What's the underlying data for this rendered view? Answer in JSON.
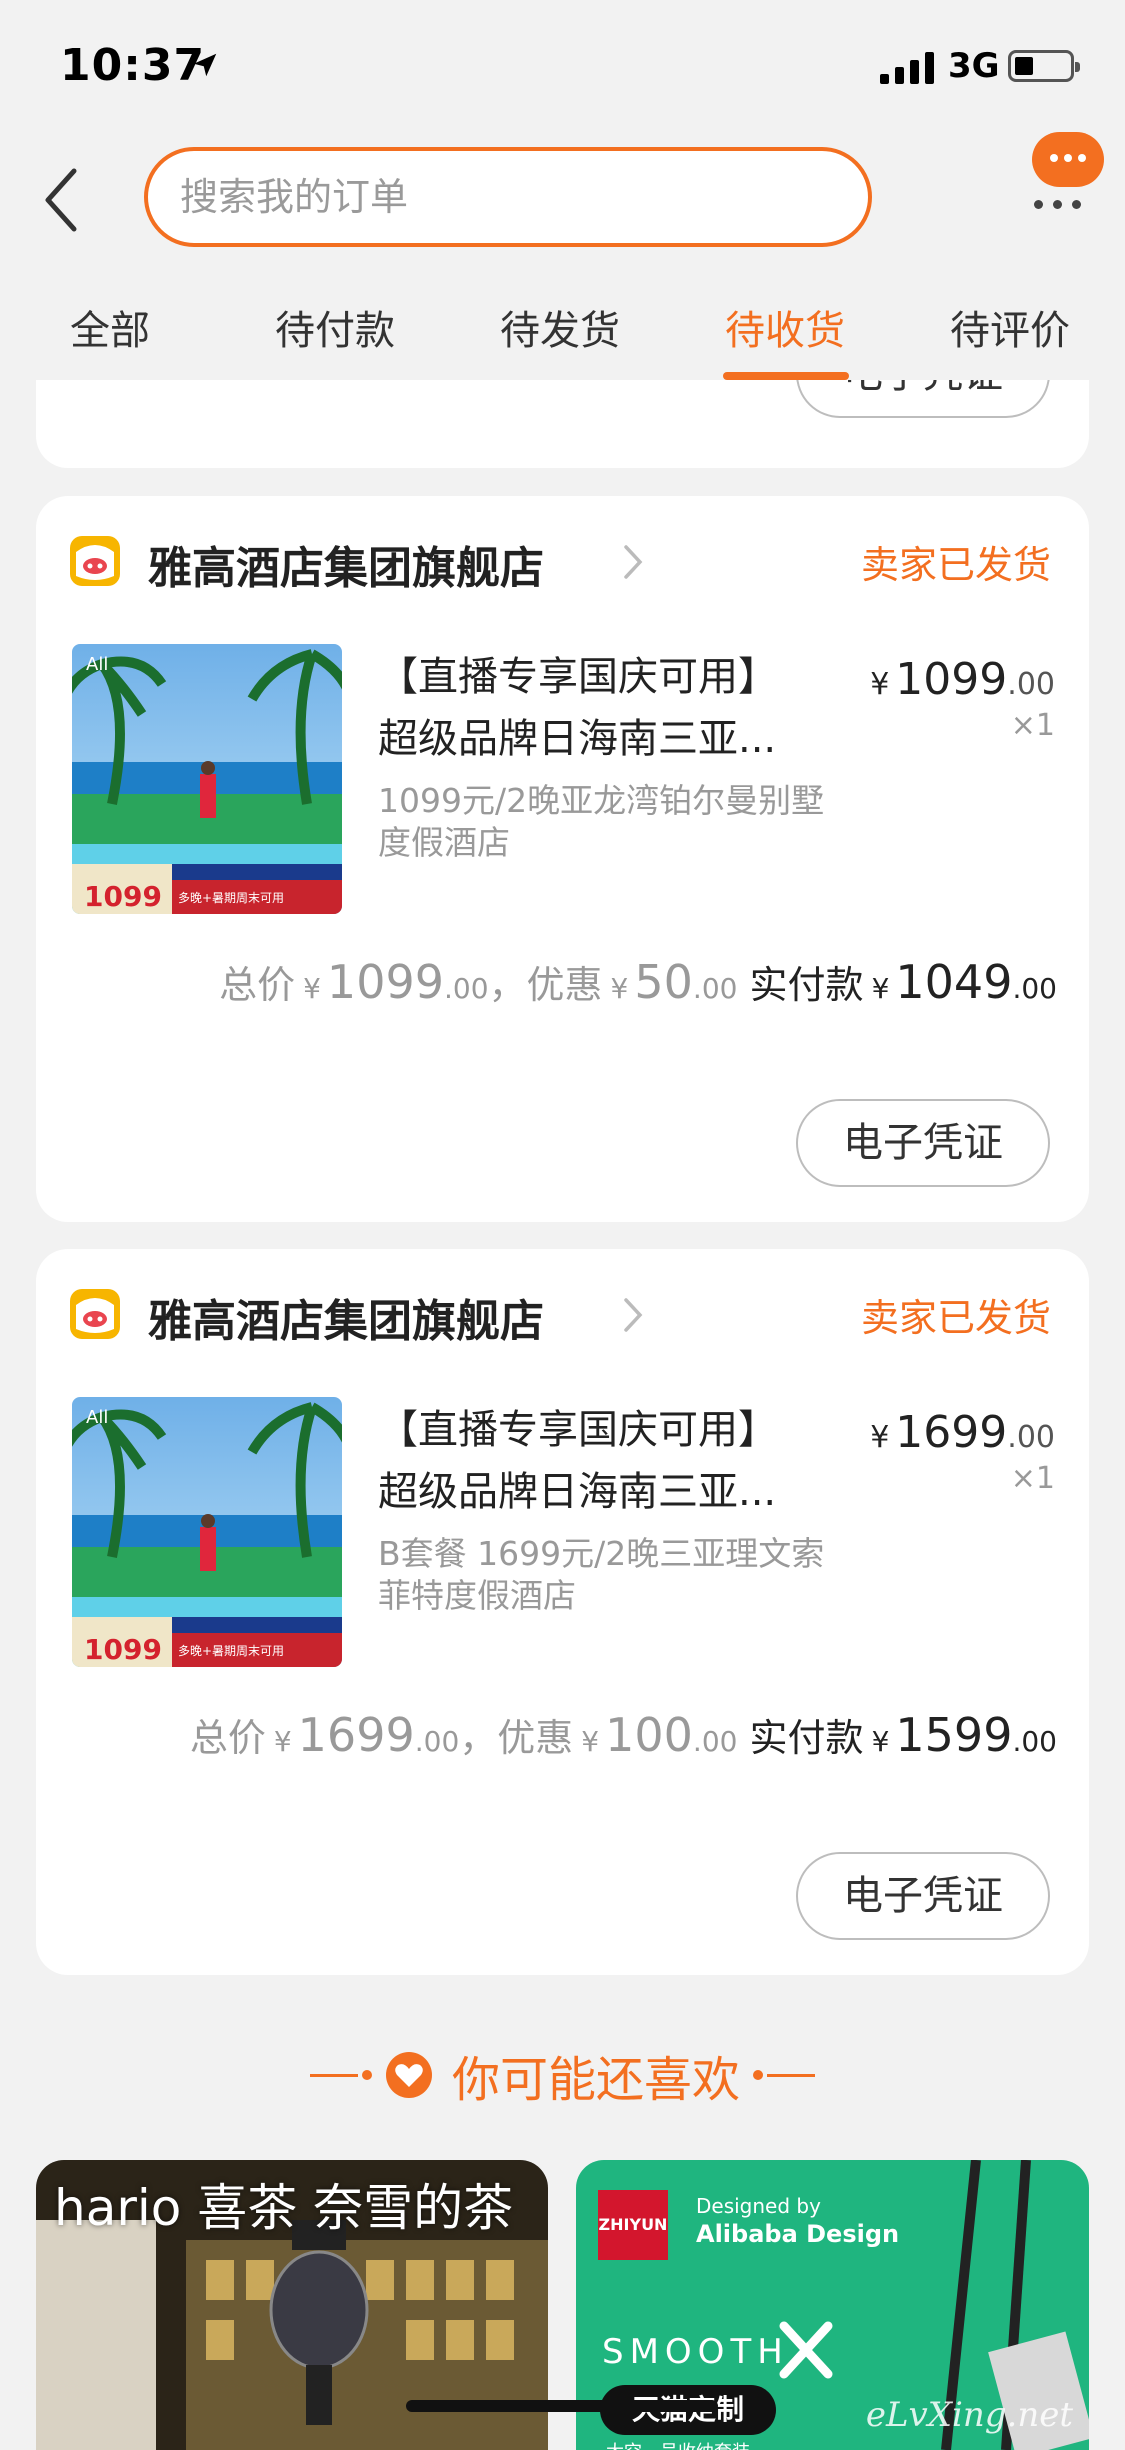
{
  "status_bar": {
    "time": "10:37",
    "network": "3G"
  },
  "search": {
    "placeholder": "搜索我的订单"
  },
  "tabs": [
    {
      "label": "全部"
    },
    {
      "label": "待付款"
    },
    {
      "label": "待发货"
    },
    {
      "label": "待收货",
      "active": true
    },
    {
      "label": "待评价"
    }
  ],
  "top_card": {
    "voucher_button": "电子凭证"
  },
  "orders": [
    {
      "shop_name": "雅高酒店集团旗舰店",
      "status": "卖家已发货",
      "product_title_1": "【直播专享国庆可用】",
      "product_title_2": "超级品牌日海南三亚...",
      "spec": "1099元/2晚亚龙湾铂尔曼别墅度假酒店",
      "price_currency": "¥",
      "price_int": "1099",
      "price_dec": ".00",
      "quantity": "×1",
      "total_label": "总价",
      "total_int": "1099",
      "total_dec": ".00",
      "discount_label": "，优惠",
      "discount_int": "50",
      "discount_dec": ".00",
      "paid_label": "实付款",
      "paid_int": "1049",
      "paid_dec": ".00",
      "voucher_button": "电子凭证",
      "thumb_price": "1099",
      "thumb_caption": "多晚+暑期周末可用"
    },
    {
      "shop_name": "雅高酒店集团旗舰店",
      "status": "卖家已发货",
      "product_title_1": "【直播专享国庆可用】",
      "product_title_2": "超级品牌日海南三亚...",
      "spec": "B套餐 1699元/2晚三亚理文索菲特度假酒店",
      "price_currency": "¥",
      "price_int": "1699",
      "price_dec": ".00",
      "quantity": "×1",
      "total_label": "总价",
      "total_int": "1699",
      "total_dec": ".00",
      "discount_label": "，优惠",
      "discount_int": "100",
      "discount_dec": ".00",
      "paid_label": "实付款",
      "paid_int": "1599",
      "paid_dec": ".00",
      "voucher_button": "电子凭证",
      "thumb_price": "1099",
      "thumb_caption": "多晚+暑期周末可用"
    }
  ],
  "recommend": {
    "title": "你可能还喜欢",
    "item1_label": "hario 喜茶 奈雪的茶",
    "item2": {
      "brand": "ZHIYUN",
      "designed_by": "Designed by",
      "designer": "Alibaba Design",
      "product": "SMOOTH",
      "badge": "天猫定制",
      "tagline": "太空一号收纳套装"
    },
    "watermark": "eLvXing.net"
  },
  "colors": {
    "accent": "#f36f20",
    "background": "#f2f2f2"
  },
  "icons": [
    "location-arrow-icon",
    "signal-icon",
    "battery-icon",
    "back-icon",
    "chat-icon",
    "more-icon",
    "shop-icon",
    "chevron-right-icon",
    "heart-icon"
  ]
}
